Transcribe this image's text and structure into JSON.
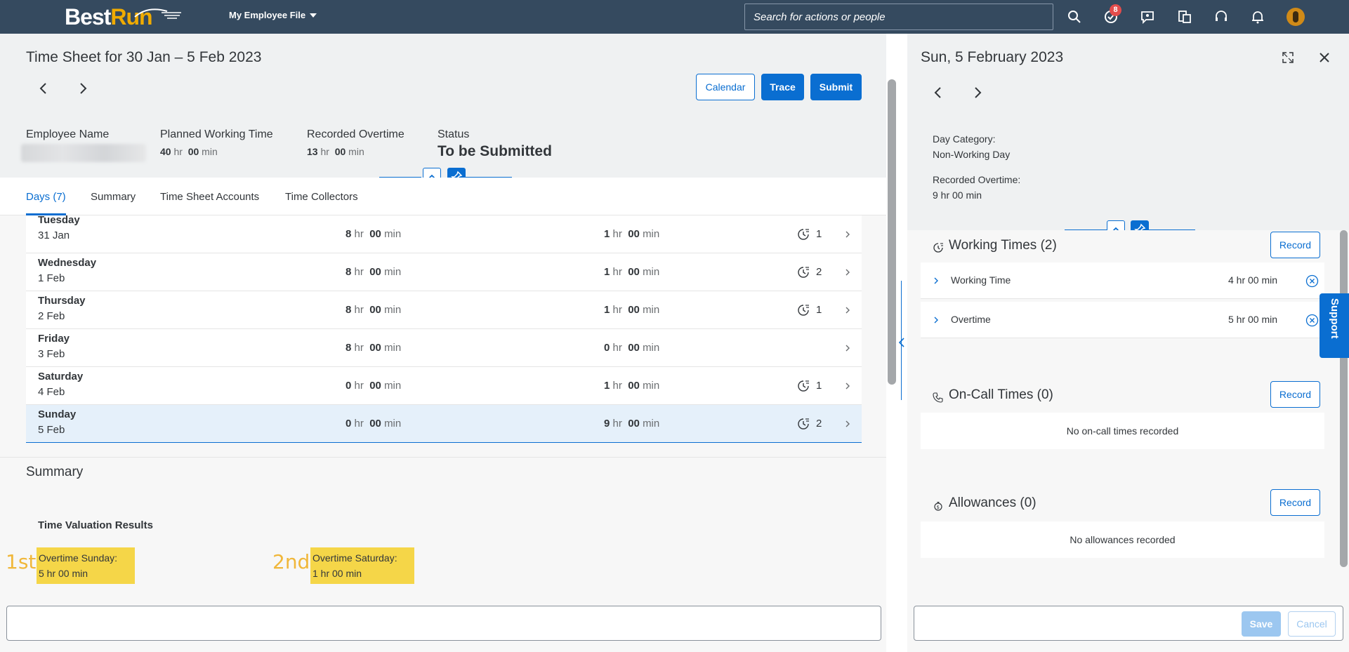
{
  "shell": {
    "logo_best": "Best",
    "logo_run": "Run",
    "menu_label": "My Employee File",
    "search_placeholder": "Search for actions or people",
    "notification_count": "8",
    "icons": [
      "search-icon",
      "task-check-icon",
      "feedback-icon",
      "org-chart-icon",
      "headset-icon",
      "bell-icon",
      "avatar"
    ]
  },
  "timesheet": {
    "title": "Time Sheet for 30 Jan – 5 Feb 2023",
    "buttons": {
      "calendar": "Calendar",
      "trace": "Trace",
      "submit": "Submit"
    },
    "attributes": {
      "employee_name_label": "Employee Name",
      "planned_label": "Planned Working Time",
      "planned_hr": "40",
      "planned_min": "00",
      "overtime_label": "Recorded Overtime",
      "overtime_hr": "13",
      "overtime_min": "00",
      "status_label": "Status",
      "status_value": "To be Submitted",
      "unit_hr": "hr",
      "unit_min": "min"
    },
    "tabs": [
      "Days (7)",
      "Summary",
      "Time Sheet Accounts",
      "Time Collectors"
    ],
    "rows": [
      {
        "day": "Tuesday",
        "date": "31 Jan",
        "planned_hr": "8",
        "planned_min": "00",
        "recorded_hr": "1",
        "recorded_min": "00",
        "count": "1"
      },
      {
        "day": "Wednesday",
        "date": "1 Feb",
        "planned_hr": "8",
        "planned_min": "00",
        "recorded_hr": "1",
        "recorded_min": "00",
        "count": "2"
      },
      {
        "day": "Thursday",
        "date": "2 Feb",
        "planned_hr": "8",
        "planned_min": "00",
        "recorded_hr": "1",
        "recorded_min": "00",
        "count": "1"
      },
      {
        "day": "Friday",
        "date": "3 Feb",
        "planned_hr": "8",
        "planned_min": "00",
        "recorded_hr": "0",
        "recorded_min": "00",
        "count": ""
      },
      {
        "day": "Saturday",
        "date": "4 Feb",
        "planned_hr": "0",
        "planned_min": "00",
        "recorded_hr": "1",
        "recorded_min": "00",
        "count": "1"
      },
      {
        "day": "Sunday",
        "date": "5 Feb",
        "planned_hr": "0",
        "planned_min": "00",
        "recorded_hr": "9",
        "recorded_min": "00",
        "count": "2"
      }
    ],
    "summary": {
      "title": "Summary",
      "tvr_title": "Time Valuation Results",
      "item1_label": "Overtime Sunday:",
      "item1_value": "5 hr 00 min",
      "item1_rank": "1st",
      "item2_label": "Overtime Saturday:",
      "item2_value": "1 hr 00 min",
      "item2_rank": "2nd"
    }
  },
  "detail": {
    "title": "Sun, 5 February 2023",
    "day_category_label": "Day Category:",
    "day_category_value": "Non-Working Day",
    "recorded_overtime_label": "Recorded Overtime:",
    "recorded_overtime_value": "9 hr 00 min",
    "working_times_title": "Working Times (2)",
    "record_label": "Record",
    "working_items": [
      {
        "label": "Working Time",
        "value": "4 hr 00 min"
      },
      {
        "label": "Overtime",
        "value": "5 hr 00 min"
      }
    ],
    "oncall_title": "On-Call Times (0)",
    "oncall_empty": "No on-call times recorded",
    "allowances_title": "Allowances (0)",
    "allowances_empty": "No allowances recorded",
    "save_label": "Save",
    "cancel_label": "Cancel",
    "support_label": "Support"
  }
}
